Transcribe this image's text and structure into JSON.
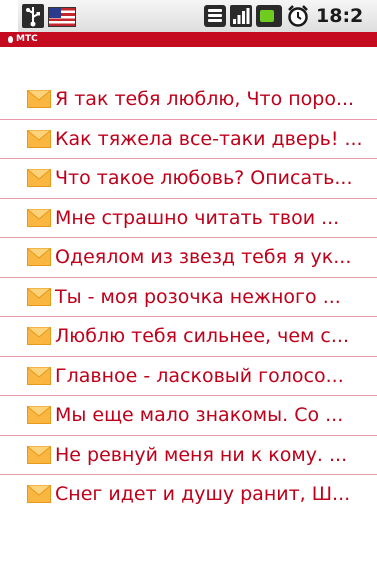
{
  "status_bar": {
    "time": "18:2",
    "icons": [
      "usb-icon",
      "us-flag-icon",
      "wifi-icon",
      "signal-icon",
      "battery-icon",
      "alarm-icon"
    ],
    "battery_color": "#6ecb1f"
  },
  "header": {
    "brand": "МТС",
    "bar_color": "#c40b1f"
  },
  "list": {
    "item_icon": "envelope-icon",
    "text_color": "#c0001a",
    "items": [
      "Я так тебя люблю, Что поро...",
      "Как тяжела все-таки дверь! ...",
      "Что такое любовь? Описать...",
      "Мне страшно читать твои ...",
      "Одеялом из звезд тебя я ук...",
      "Ты - моя розочка нежного ...",
      "Люблю тебя сильнее, чем с...",
      "Главное - ласковый голосо...",
      "Мы еще мало знакомы. Со ...",
      "Не ревнуй меня ни к кому. ...",
      "Снег идет и душу ранит, Ш..."
    ]
  }
}
